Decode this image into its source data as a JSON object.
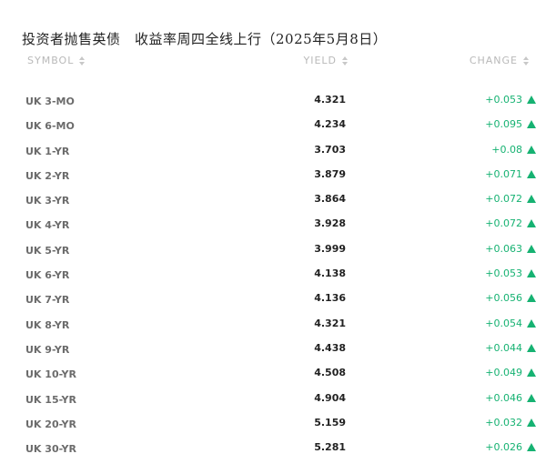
{
  "headline": "投资者抛售英债　收益率周四全线上行（2025年5月8日）",
  "table": {
    "columns": {
      "symbol": "SYMBOL",
      "yield": "YIELD",
      "change": "CHANGE"
    },
    "rows": [
      {
        "symbol": "UK 3-MO",
        "yield": "4.321",
        "change": "+0.053",
        "direction": "up"
      },
      {
        "symbol": "UK 6-MO",
        "yield": "4.234",
        "change": "+0.095",
        "direction": "up"
      },
      {
        "symbol": "UK 1-YR",
        "yield": "3.703",
        "change": "+0.08",
        "direction": "up"
      },
      {
        "symbol": "UK 2-YR",
        "yield": "3.879",
        "change": "+0.071",
        "direction": "up"
      },
      {
        "symbol": "UK 3-YR",
        "yield": "3.864",
        "change": "+0.072",
        "direction": "up"
      },
      {
        "symbol": "UK 4-YR",
        "yield": "3.928",
        "change": "+0.072",
        "direction": "up"
      },
      {
        "symbol": "UK 5-YR",
        "yield": "3.999",
        "change": "+0.063",
        "direction": "up"
      },
      {
        "symbol": "UK 6-YR",
        "yield": "4.138",
        "change": "+0.053",
        "direction": "up"
      },
      {
        "symbol": "UK 7-YR",
        "yield": "4.136",
        "change": "+0.056",
        "direction": "up"
      },
      {
        "symbol": "UK 8-YR",
        "yield": "4.321",
        "change": "+0.054",
        "direction": "up"
      },
      {
        "symbol": "UK 9-YR",
        "yield": "4.438",
        "change": "+0.044",
        "direction": "up"
      },
      {
        "symbol": "UK 10-YR",
        "yield": "4.508",
        "change": "+0.049",
        "direction": "up"
      },
      {
        "symbol": "UK 15-YR",
        "yield": "4.904",
        "change": "+0.046",
        "direction": "up"
      },
      {
        "symbol": "UK 20-YR",
        "yield": "5.159",
        "change": "+0.032",
        "direction": "up"
      },
      {
        "symbol": "UK 30-YR",
        "yield": "5.281",
        "change": "+0.026",
        "direction": "up"
      }
    ]
  },
  "colors": {
    "positive": "#16b272",
    "header_text": "#b9b9b9",
    "symbol_text": "#6b6b6b"
  },
  "icons": {
    "sort": "sort-icon",
    "up": "up-arrow-icon"
  }
}
